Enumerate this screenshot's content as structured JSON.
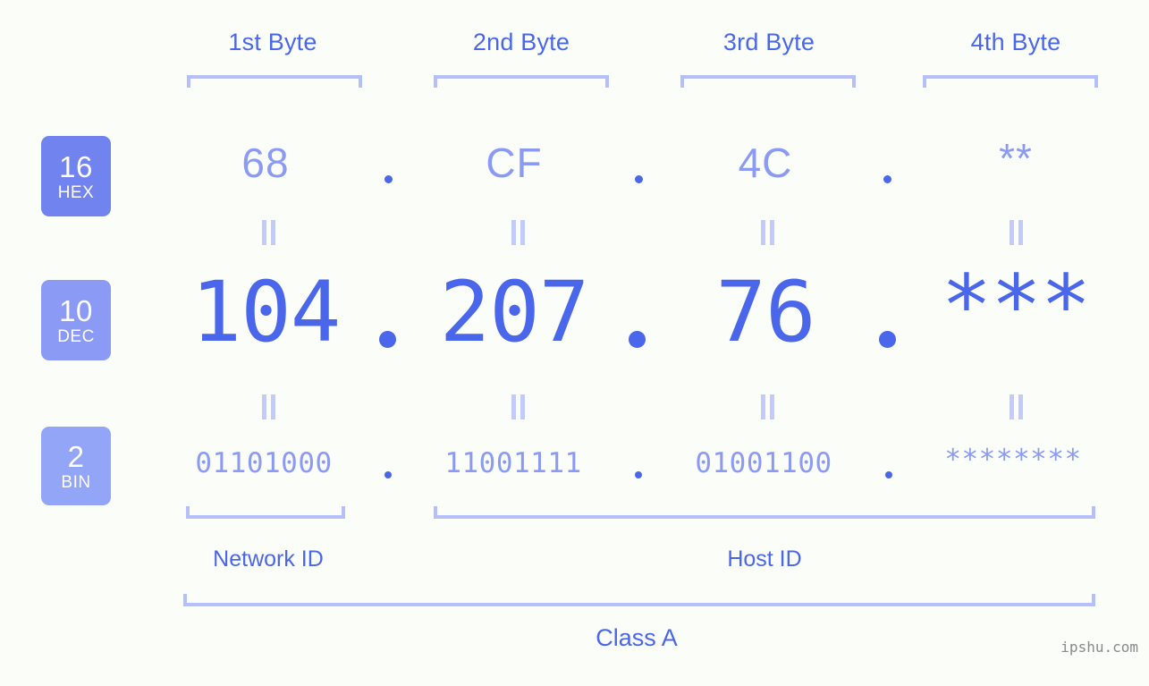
{
  "page": {
    "background": "#fbfdf8",
    "accent": "#4a66ea",
    "accent_light": "#8b9af4",
    "bracket_color": "#b5bffa",
    "watermark": "ipshu.com"
  },
  "byte_headers": [
    {
      "label": "1st Byte"
    },
    {
      "label": "2nd Byte"
    },
    {
      "label": "3rd Byte"
    },
    {
      "label": "4th Byte"
    }
  ],
  "bases": [
    {
      "num": "16",
      "name": "HEX",
      "color": "#7183ef"
    },
    {
      "num": "10",
      "name": "DEC",
      "color": "#8b9af4"
    },
    {
      "num": "2",
      "name": "BIN",
      "color": "#93a5f6"
    }
  ],
  "rows": {
    "hex": {
      "values": [
        "68",
        "CF",
        "4C",
        "**"
      ],
      "separator": "."
    },
    "dec": {
      "values": [
        "104",
        "207",
        "76",
        "***"
      ],
      "separator": "."
    },
    "bin": {
      "values": [
        "01101000",
        "11001111",
        "01001100",
        "********"
      ],
      "separator": "."
    }
  },
  "equals_marker": "=",
  "sections": [
    {
      "label": "Network ID"
    },
    {
      "label": "Host ID"
    }
  ],
  "class": {
    "label": "Class A"
  }
}
